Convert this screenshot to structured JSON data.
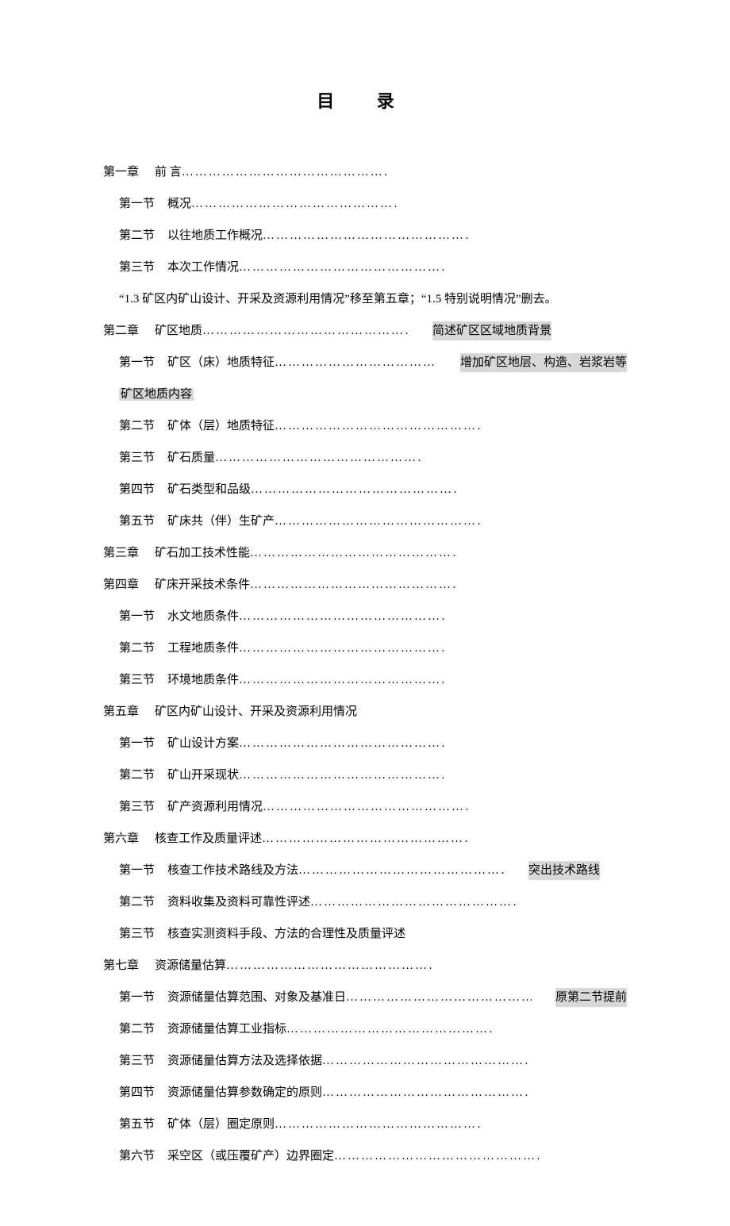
{
  "title": "目 录",
  "entries": [
    {
      "type": "chapter",
      "num": "第一章",
      "label": "前 言",
      "dots": true
    },
    {
      "type": "section",
      "num": "第一节",
      "label": "概况",
      "dots": true
    },
    {
      "type": "section",
      "num": "第二节",
      "label": "以往地质工作概况",
      "dots": true
    },
    {
      "type": "section",
      "num": "第三节",
      "label": "本次工作情况",
      "dots": true
    },
    {
      "type": "note",
      "text": "“1.3 矿区内矿山设计、开采及资源利用情况”移至第五章；“1.5 特别说明情况”删去。"
    },
    {
      "type": "chapter",
      "num": "第二章",
      "label": "矿区地质",
      "dots": true,
      "annot": "简述矿区区域地质背景"
    },
    {
      "type": "section",
      "num": "第一节",
      "label": "矿区（床）地质特征",
      "dots": true,
      "annot": "增加矿区地层、构造、岩浆岩等"
    },
    {
      "type": "cont",
      "text": "矿区地质内容",
      "hl": true
    },
    {
      "type": "section",
      "num": "第二节",
      "label": "矿体（层）地质特征",
      "dots": true
    },
    {
      "type": "section",
      "num": "第三节",
      "label": "矿石质量",
      "dots": true
    },
    {
      "type": "section",
      "num": "第四节",
      "label": "矿石类型和品级",
      "dots": true
    },
    {
      "type": "section",
      "num": "第五节",
      "label": "矿床共（伴）生矿产",
      "dots": true
    },
    {
      "type": "chapter",
      "num": "第三章",
      "label": "矿石加工技术性能",
      "dots": true
    },
    {
      "type": "chapter",
      "num": "第四章",
      "label": "矿床开采技术条件",
      "dots": true
    },
    {
      "type": "section",
      "num": "第一节",
      "label": "水文地质条件",
      "dots": true
    },
    {
      "type": "section",
      "num": "第二节",
      "label": "工程地质条件",
      "dots": true
    },
    {
      "type": "section",
      "num": "第三节",
      "label": "环境地质条件",
      "dots": true
    },
    {
      "type": "chapter",
      "num": "第五章",
      "label": "矿区内矿山设计、开采及资源利用情况",
      "dots": false
    },
    {
      "type": "section",
      "num": "第一节",
      "label": "矿山设计方案",
      "dots": true
    },
    {
      "type": "section",
      "num": "第二节",
      "label": "矿山开采现状",
      "dots": true
    },
    {
      "type": "section",
      "num": "第三节",
      "label": "矿产资源利用情况",
      "dots": true
    },
    {
      "type": "chapter",
      "num": "第六章",
      "label": "核查工作及质量评述",
      "dots": true
    },
    {
      "type": "section",
      "num": "第一节",
      "label": "核查工作技术路线及方法",
      "dots": true,
      "annot": "突出技术路线"
    },
    {
      "type": "section",
      "num": "第二节",
      "label": "资料收集及资料可靠性评述",
      "dots": true
    },
    {
      "type": "section",
      "num": "第三节",
      "label": "核查实测资料手段、方法的合理性及质量评述",
      "dots": false
    },
    {
      "type": "chapter",
      "num": "第七章",
      "label": "资源储量估算",
      "dots": true
    },
    {
      "type": "section",
      "num": "第一节",
      "label": "资源储量估算范围、对象及基准日",
      "dots": true,
      "annot": "原第二节提前"
    },
    {
      "type": "section",
      "num": "第二节",
      "label": "资源储量估算工业指标",
      "dots": true
    },
    {
      "type": "section",
      "num": "第三节",
      "label": "资源储量估算方法及选择依据",
      "dots": true
    },
    {
      "type": "section",
      "num": "第四节",
      "label": "资源储量估算参数确定的原则",
      "dots": true
    },
    {
      "type": "section",
      "num": "第五节",
      "label": "矿体（层）圈定原则",
      "dots": true
    },
    {
      "type": "section",
      "num": "第六节",
      "label": "采空区（或压覆矿产）边界圈定",
      "dots": true
    }
  ]
}
